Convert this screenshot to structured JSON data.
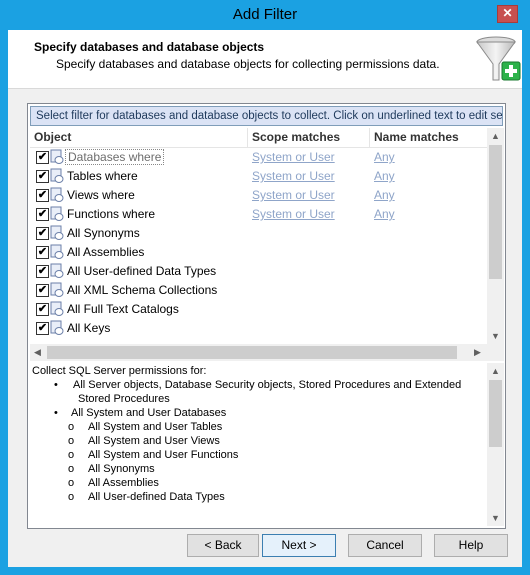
{
  "window": {
    "title": "Add Filter",
    "close_glyph": "✕"
  },
  "header": {
    "title": "Specify databases and database objects",
    "subtitle": "Specify databases and database objects for collecting permissions data."
  },
  "info_bar": "Select filter for databases and database objects to collect. Click on underlined text to edit settings.",
  "grid": {
    "columns": [
      "Object",
      "Scope matches",
      "Name matches"
    ],
    "rows": [
      {
        "label": "Databases where",
        "scope": "System or User",
        "name": "Any",
        "checked": true
      },
      {
        "label": "Tables where",
        "scope": "System or User",
        "name": "Any",
        "checked": true
      },
      {
        "label": "Views where",
        "scope": "System or User",
        "name": "Any",
        "checked": true
      },
      {
        "label": "Functions where",
        "scope": "System or User",
        "name": "Any",
        "checked": true
      },
      {
        "label": "All Synonyms",
        "checked": true
      },
      {
        "label": "All Assemblies",
        "checked": true
      },
      {
        "label": "All User-defined Data Types",
        "checked": true
      },
      {
        "label": "All XML Schema Collections",
        "checked": true
      },
      {
        "label": "All Full Text Catalogs",
        "checked": true
      },
      {
        "label": "All Keys",
        "checked": true
      }
    ]
  },
  "description": {
    "intro": "Collect SQL Server permissions for:",
    "l1": "All Server objects, Database Security objects, Stored Procedures and Extended",
    "l1b": "Stored Procedures",
    "l2": "All System and User Databases",
    "subitems": [
      "All System and User Tables",
      "All System and User Views",
      "All System and User Functions",
      "All Synonyms",
      "All Assemblies",
      "All User-defined Data Types"
    ]
  },
  "buttons": {
    "back": "< Back",
    "next": "Next >",
    "cancel": "Cancel",
    "help": "Help"
  },
  "colors": {
    "titlebar": "#1ba1e2",
    "info_bar_bg": "#dbe3f5",
    "link": "#8fa5c9"
  },
  "icons": [
    "filter-funnel-icon",
    "check-icon",
    "database-object-icon"
  ]
}
